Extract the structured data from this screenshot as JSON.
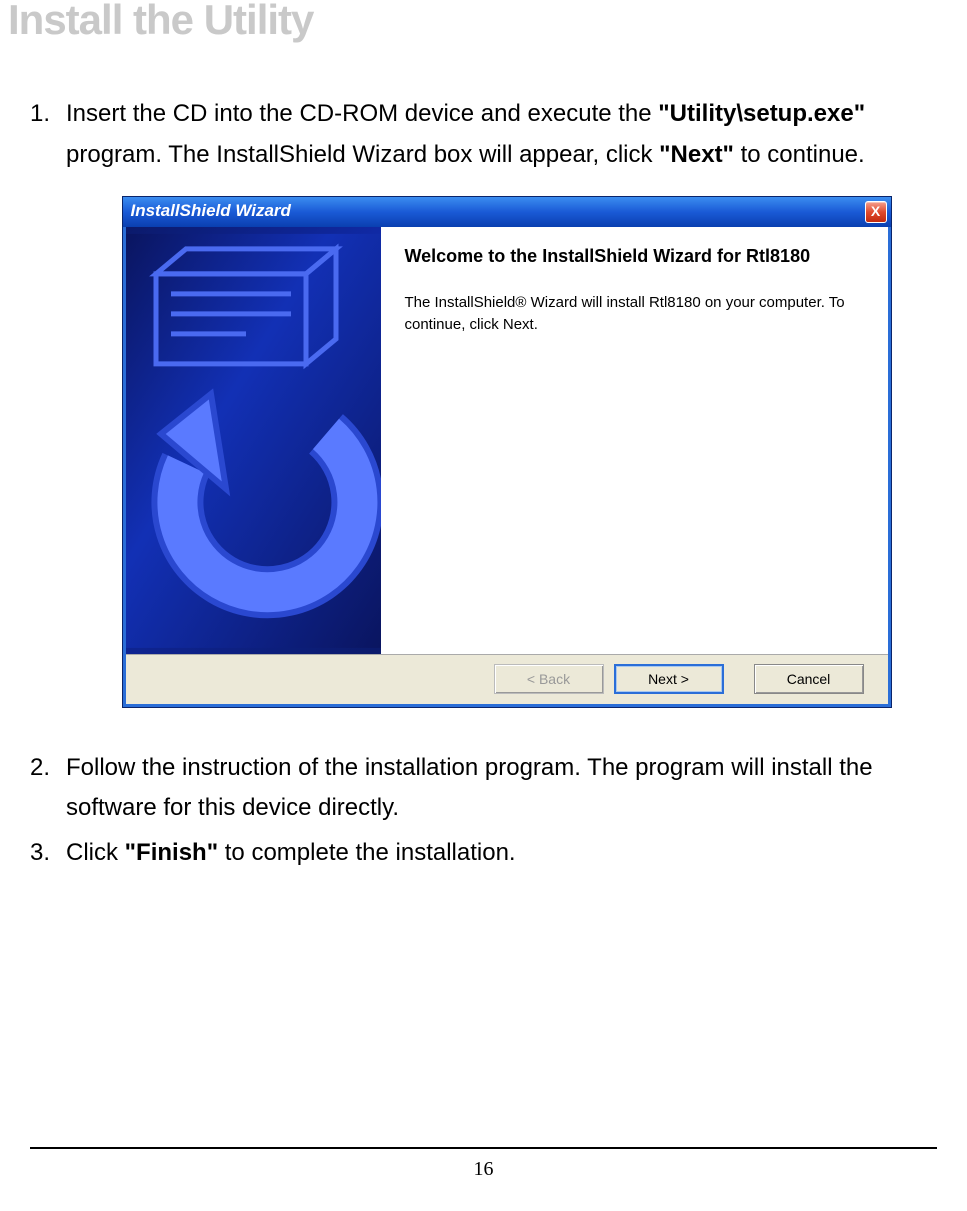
{
  "page": {
    "title": "Install the Utility",
    "page_number": "16"
  },
  "steps": [
    {
      "pre1": "Insert the CD into the CD-ROM device and execute the ",
      "bold1": "\"Utility\\setup.exe\"",
      "mid1": " program. The InstallShield Wizard box will appear, click ",
      "bold2": "\"Next\"",
      "post1": " to continue."
    },
    {
      "text": "Follow the instruction of the installation program. The program will install the software for this device directly."
    },
    {
      "pre1": "Click ",
      "bold1": "\"Finish\"",
      "post1": " to complete the installation."
    }
  ],
  "wizard": {
    "titlebar_text": "InstallShield Wizard",
    "close_label": "X",
    "heading": "Welcome to the InstallShield Wizard for Rtl8180",
    "description": "The InstallShield® Wizard will install Rtl8180 on your computer.  To continue, click Next.",
    "buttons": {
      "back": "< Back",
      "next": "Next >",
      "cancel": "Cancel"
    }
  }
}
